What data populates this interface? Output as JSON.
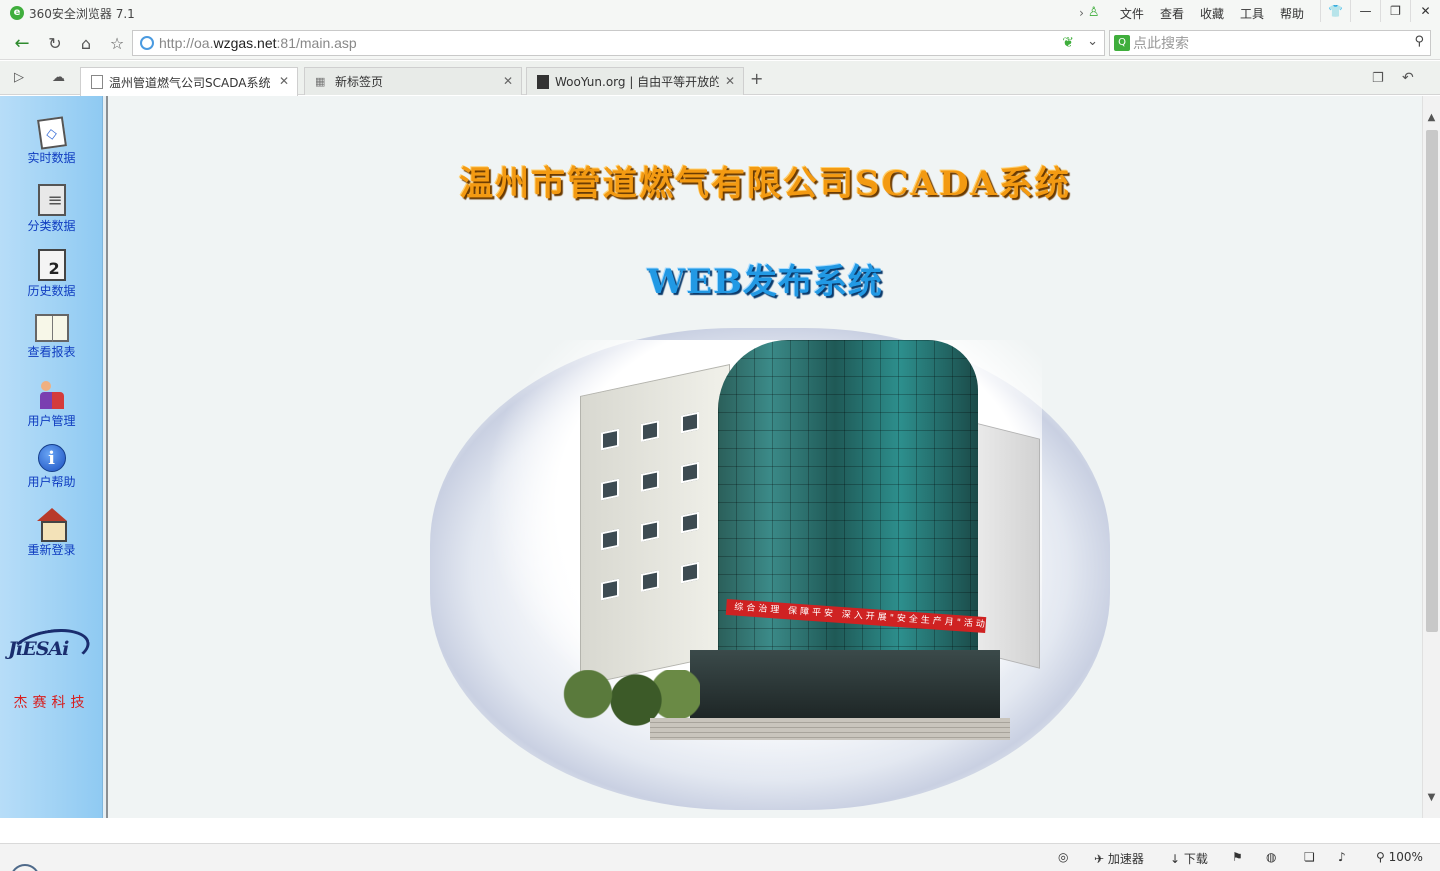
{
  "browser": {
    "window_title": "360安全浏览器 7.1",
    "menu": [
      "文件",
      "查看",
      "收藏",
      "工具",
      "帮助"
    ],
    "window_buttons": {
      "skin": "👕",
      "minimize": "—",
      "restore": "❐",
      "close": "✕"
    },
    "url_prefix": "http://oa.",
    "url_domain": "wzgas.net",
    "url_suffix": ":81/main.asp",
    "search_placeholder": "点此搜索",
    "tabs": [
      {
        "label": "温州管道燃气公司SCADA系统",
        "active": true
      },
      {
        "label": "新标签页",
        "active": false
      },
      {
        "label": "WooYun.org | 自由平等开放的",
        "active": false
      }
    ],
    "status": {
      "accelerator": "加速器",
      "download": "下载",
      "zoom": "100%"
    }
  },
  "sidebar": {
    "items": [
      {
        "label": "实时数据",
        "icon": "realtime-data-icon"
      },
      {
        "label": "分类数据",
        "icon": "category-data-icon"
      },
      {
        "label": "历史数据",
        "icon": "history-data-icon"
      },
      {
        "label": "查看报表",
        "icon": "report-book-icon"
      },
      {
        "label": "用户管理",
        "icon": "users-icon"
      },
      {
        "label": "用户帮助",
        "icon": "info-icon"
      },
      {
        "label": "重新登录",
        "icon": "home-icon"
      }
    ],
    "brand_logo_text": "JiESAi",
    "brand_cn": "杰赛科技"
  },
  "main": {
    "title": "温州市管道燃气有限公司SCADA系统",
    "subtitle": "WEB发布系统",
    "banner_text": "综合治理 保障平安 深入开展\"安全生产月\"活动"
  }
}
